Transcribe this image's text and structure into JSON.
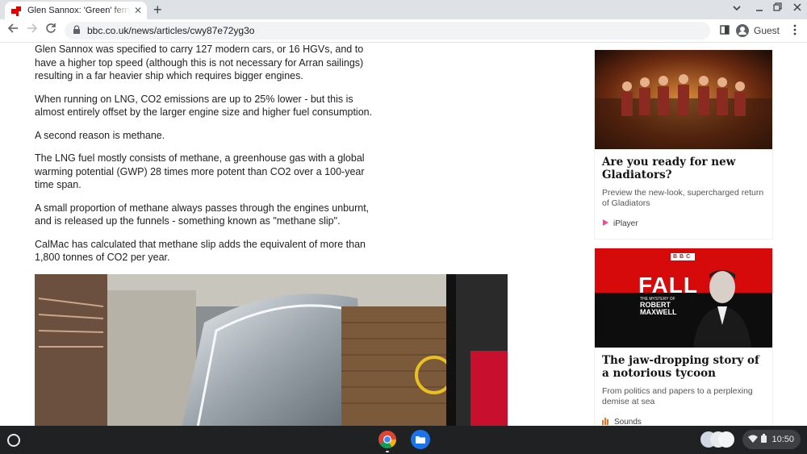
{
  "browser": {
    "tab_title": "Glen Sannox: 'Green' ferry has hi",
    "tab_close": "✕",
    "new_tab": "+",
    "url": "bbc.co.uk/news/articles/cwy87e72yg3o",
    "profile_label": "Guest",
    "icons": [
      "back-icon",
      "forward-icon",
      "reload-icon",
      "lock-icon",
      "side-panel-icon",
      "profile-icon",
      "kebab-menu-icon",
      "tab-search-icon",
      "minimize-icon",
      "maximize-icon",
      "close-icon"
    ]
  },
  "article": {
    "paragraphs": [
      "Glen Sannox was specified to carry 127 modern cars, or 16 HGVs, and to have a higher top speed (although this is not necessary for Arran sailings) resulting in a far heavier ship which requires bigger engines.",
      "When running on LNG, CO2 emissions are up to 25% lower - but this is almost entirely offset by the larger engine size and higher fuel consumption.",
      "A second reason is methane.",
      "The LNG fuel mostly consists of methane, a greenhouse gas with a global warming potential (GWP) 28 times more potent than CO2 over a 100-year time span.",
      "A small proportion of methane always passes through the engines unburnt, and is released up the funnels - something known as \"methane slip\".",
      "CalMac has calculated that methane slip adds the equivalent of more than 1,800 tonnes of CO2 per year."
    ]
  },
  "sidebar": {
    "cards": [
      {
        "title": "Are you ready for new Gladiators?",
        "description": "Preview the new-look, supercharged return of Gladiators",
        "source": "iPlayer"
      },
      {
        "title": "The jaw-dropping story of a notorious tycoon",
        "description": "From politics and papers to a perplexing demise at sea",
        "source": "Sounds",
        "image_text": {
          "brand": "BBC",
          "title": "FALL",
          "subtitle_small": "THE MYSTERY OF",
          "subtitle": "ROBERT MAXWELL"
        }
      }
    ]
  },
  "taskbar": {
    "time": "10:50",
    "apps": [
      "chrome-icon",
      "files-icon"
    ]
  },
  "colors": {
    "bbc_red": "#e00000",
    "chrome_frame": "#dee1e6",
    "taskbar": "#1f2123"
  }
}
